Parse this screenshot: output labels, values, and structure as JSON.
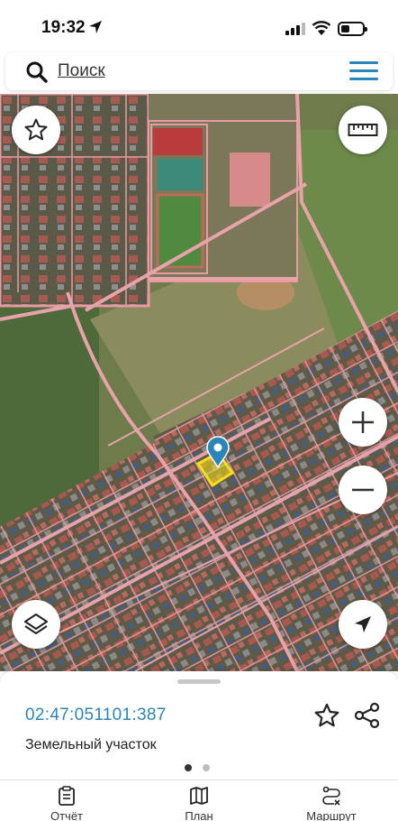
{
  "status_bar": {
    "time": "19:32"
  },
  "search": {
    "placeholder": "Поиск"
  },
  "map": {
    "base": "satellite imagery",
    "buttons": [
      "favorites-star-icon",
      "ruler-icon",
      "zoom-in-icon",
      "zoom-out-icon",
      "layers-icon",
      "locate-arrow-icon"
    ]
  },
  "object_card": {
    "cadastral_number": "02:47:051101:387",
    "object_type": "Земельный участок",
    "page_indicator": {
      "pages": 2,
      "active": 1
    }
  },
  "tabbar": {
    "tabs": [
      {
        "label": "Отчёт",
        "icon": "report-clipboard-icon"
      },
      {
        "label": "План",
        "icon": "map-plan-icon"
      },
      {
        "label": "Маршрут",
        "icon": "route-icon"
      }
    ]
  },
  "colors": {
    "accent": "#2a86b9",
    "cadastral_lines": "#e89aa2",
    "selected_parcel": "#f2e21a",
    "marker": "#2a86b9"
  }
}
